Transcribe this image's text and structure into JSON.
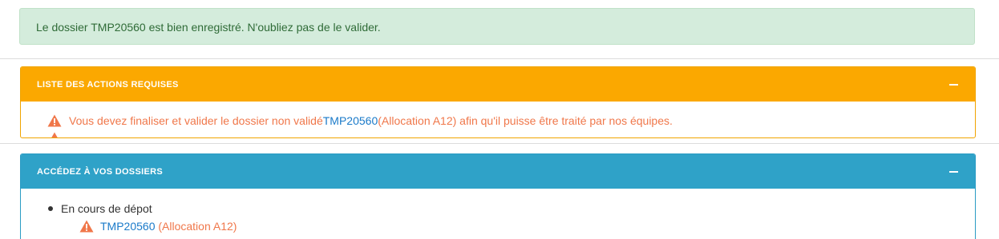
{
  "alert": {
    "message": "Le dossier TMP20560 est bien enregistré. N'oubliez pas de le valider."
  },
  "actions_panel": {
    "title": "LISTE DES ACTIONS REQUISES",
    "color": "#fba800",
    "items": [
      {
        "prefix": "Vous devez finaliser et valider le dossier non validé ",
        "link": "TMP20560",
        "suffix": " (Allocation A12) afin qu'il puisse être traité par nos équipes."
      }
    ]
  },
  "dossiers_panel": {
    "title": "ACCÉDEZ À VOS DOSSIERS",
    "color": "#2fa2c8",
    "groups": [
      {
        "label": "En cours de dépot",
        "items": [
          {
            "link": "TMP20560",
            "detail": "(Allocation A12)"
          }
        ]
      }
    ]
  },
  "icons": {
    "warning": "warning-triangle-icon",
    "collapse": "minus-icon"
  }
}
